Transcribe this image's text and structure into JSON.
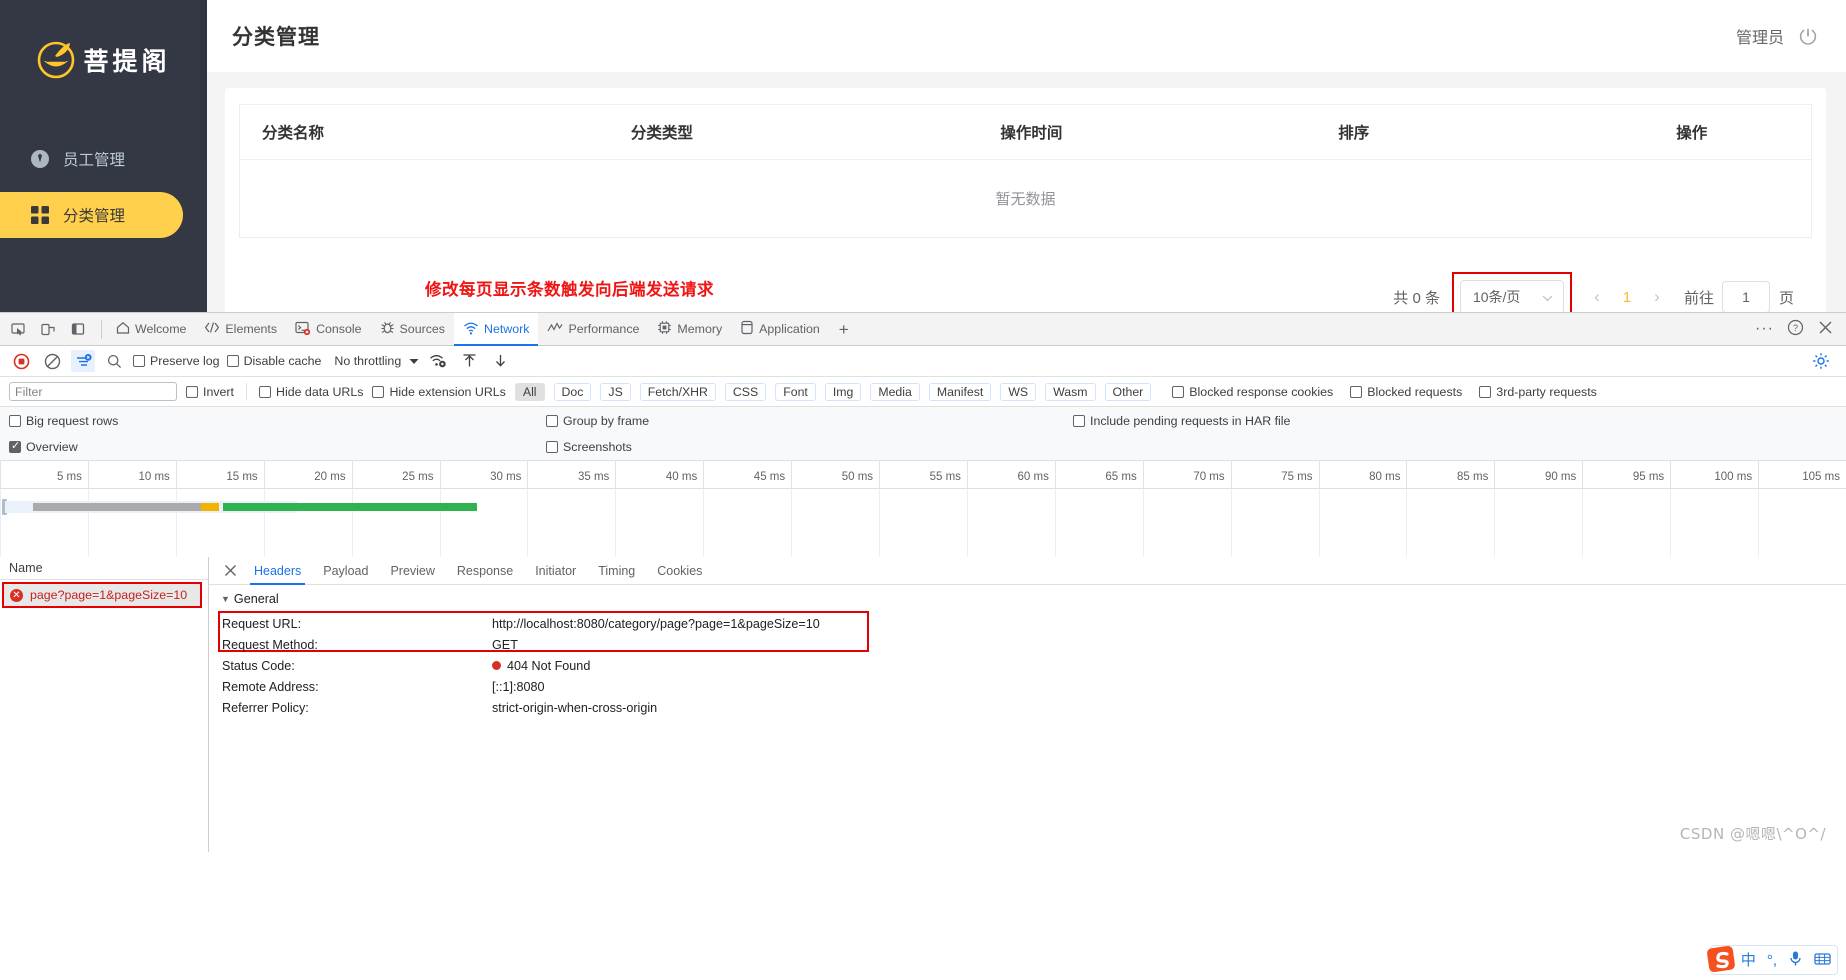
{
  "app": {
    "brand": "菩提阁",
    "page_title": "分类管理",
    "user": "管理员",
    "menu": [
      {
        "label": "员工管理",
        "icon": "tie-user-icon",
        "active": false
      },
      {
        "label": "分类管理",
        "icon": "grid-squares-icon",
        "active": true
      }
    ],
    "table": {
      "columns": [
        "分类名称",
        "分类类型",
        "操作时间",
        "排序",
        "操作"
      ],
      "rows": [],
      "empty_text": "暂无数据"
    },
    "annotation": "修改每页显示条数触发向后端发送请求",
    "pagination": {
      "total_label": "共 0 条",
      "page_size": "10条/页",
      "prev": "‹",
      "current_page": "1",
      "next": "›",
      "goto_label": "前往",
      "goto_value": "1",
      "page_unit": "页"
    }
  },
  "devtools": {
    "tabs": [
      {
        "label": "Welcome",
        "icon": "home-icon",
        "active": false
      },
      {
        "label": "Elements",
        "icon": "code-brackets-icon",
        "active": false
      },
      {
        "label": "Console",
        "icon": "console-error-icon",
        "active": false
      },
      {
        "label": "Sources",
        "icon": "bug-icon",
        "active": false
      },
      {
        "label": "Network",
        "icon": "wifi-icon",
        "active": true
      },
      {
        "label": "Performance",
        "icon": "performance-icon",
        "active": false
      },
      {
        "label": "Memory",
        "icon": "memory-chip-icon",
        "active": false
      },
      {
        "label": "Application",
        "icon": "application-icon",
        "active": false
      }
    ],
    "add_tab": "+",
    "toolbar": {
      "record": "record-stop-icon",
      "clear": "clear-icon",
      "filter_toggle": "filter-icon",
      "search": "search-icon",
      "preserve_log": "Preserve log",
      "preserve_log_checked": false,
      "disable_cache": "Disable cache",
      "disable_cache_checked": false,
      "throttling": "No throttling",
      "wifi_settings": "network-conditions-icon",
      "import_har": "import-har-icon",
      "export_har": "export-har-icon",
      "settings": "settings-gear-icon"
    },
    "filterbar": {
      "filter_placeholder": "Filter",
      "invert": "Invert",
      "hide_data_urls": "Hide data URLs",
      "hide_extension_urls": "Hide extension URLs",
      "types": [
        "All",
        "Doc",
        "JS",
        "Fetch/XHR",
        "CSS",
        "Font",
        "Img",
        "Media",
        "Manifest",
        "WS",
        "Wasm",
        "Other"
      ],
      "selected_type": "All",
      "blocked_response_cookies": "Blocked response cookies",
      "blocked_requests": "Blocked requests",
      "third_party_requests": "3rd-party requests"
    },
    "options": {
      "big_request_rows": "Big request rows",
      "big_request_rows_checked": false,
      "group_by_frame": "Group by frame",
      "group_by_frame_checked": false,
      "include_pending": "Include pending requests in HAR file",
      "include_pending_checked": false,
      "overview": "Overview",
      "overview_checked": true,
      "screenshots": "Screenshots",
      "screenshots_checked": false
    },
    "timeline": {
      "ticks": [
        "5 ms",
        "10 ms",
        "15 ms",
        "20 ms",
        "25 ms",
        "30 ms",
        "35 ms",
        "40 ms",
        "45 ms",
        "50 ms",
        "55 ms",
        "60 ms",
        "65 ms",
        "70 ms",
        "75 ms",
        "80 ms",
        "85 ms",
        "90 ms",
        "95 ms",
        "100 ms",
        "105 ms"
      ]
    },
    "requests": {
      "name_header": "Name",
      "items": [
        {
          "name": "page?page=1&pageSize=10",
          "status": "error"
        }
      ]
    },
    "detail": {
      "tabs": [
        "Headers",
        "Payload",
        "Preview",
        "Response",
        "Initiator",
        "Timing",
        "Cookies"
      ],
      "active_tab": "Headers",
      "section_title": "General",
      "fields": [
        {
          "key": "Request URL:",
          "value": "http://localhost:8080/category/page?page=1&pageSize=10",
          "status": false
        },
        {
          "key": "Request Method:",
          "value": "GET",
          "status": false
        },
        {
          "key": "Status Code:",
          "value": "404 Not Found",
          "status": true
        },
        {
          "key": "Remote Address:",
          "value": "[::1]:8080",
          "status": false
        },
        {
          "key": "Referrer Policy:",
          "value": "strict-origin-when-cross-origin",
          "status": false
        }
      ]
    }
  },
  "ime": {
    "logo": "sogou-logo-icon",
    "mode": "中",
    "punct": "°,",
    "mic": "microphone-icon",
    "keyboard": "keyboard-icon"
  },
  "watermark": "CSDN @嗯嗯\\^O^/",
  "colors": {
    "sidebar_bg": "#343744",
    "accent_yellow": "#ffd04b",
    "annotation_red": "#f11414",
    "box_red": "#e40000",
    "devtools_link": "#1a73e8",
    "error_red": "#d93025"
  }
}
